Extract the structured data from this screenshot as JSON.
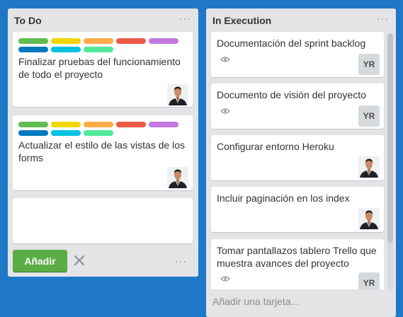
{
  "colors": {
    "board_bg": "#1f78c7",
    "label_green": "#61bd4f",
    "label_yellow": "#f2d600",
    "label_orange": "#ffab4a",
    "label_red": "#eb5a46",
    "label_purple": "#c377e0",
    "label_blue": "#0079bf",
    "label_sky": "#00c2e0",
    "label_lime": "#51e898",
    "add_button": "#5aac44"
  },
  "todo": {
    "title": "To Do",
    "menu": "···",
    "cards": [
      {
        "title": "Finalizar pruebas del funcionamiento de todo el proyecto",
        "has_labels": true,
        "member": "photo"
      },
      {
        "title": "Actualizar el estilo de las vistas de los forms",
        "has_labels": true,
        "member": "photo"
      }
    ],
    "composer_text": "",
    "add_button_label": "Añadir",
    "close_icon": "close-icon",
    "options_icon": "···"
  },
  "exec": {
    "title": "In Execution",
    "menu": "···",
    "cards": [
      {
        "title": "Documentación del sprint backlog",
        "watched": true,
        "member_initials": "YR"
      },
      {
        "title": "Documento de visión del proyecto",
        "watched": true,
        "member_initials": "YR"
      },
      {
        "title": "Configurar entorno Heroku",
        "member": "photo"
      },
      {
        "title": "Incluir paginación en los index",
        "member": "photo"
      },
      {
        "title": "Tomar pantallazos tablero Trello que muestra avances del proyecto",
        "watched": true,
        "member_initials": "YR"
      }
    ],
    "add_card_label": "Añadir una tarjeta..."
  }
}
